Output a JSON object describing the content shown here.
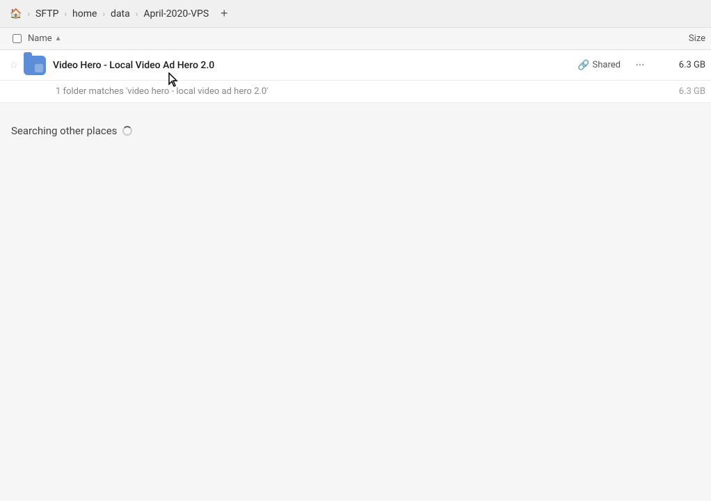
{
  "header": {
    "home_icon": "🏠",
    "breadcrumbs": [
      {
        "label": "SFTP"
      },
      {
        "label": "home"
      },
      {
        "label": "data"
      },
      {
        "label": "April-2020-VPS"
      }
    ],
    "new_tab_label": "+"
  },
  "columns": {
    "name_label": "Name",
    "sort_arrow": "▲",
    "size_label": "Size"
  },
  "file_row": {
    "name": "Video Hero - Local Video Ad Hero 2.0",
    "shared_label": "Shared",
    "size": "6.3 GB",
    "match_text": "1 folder matches 'video hero - local video ad hero 2.0'",
    "match_size": "6.3 GB"
  },
  "searching": {
    "label": "Searching other places"
  },
  "colors": {
    "folder_bg": "#5b8dd9",
    "accent": "#3d7be5"
  }
}
